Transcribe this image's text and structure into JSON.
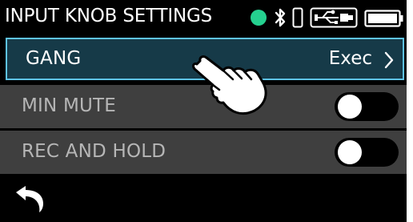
{
  "header": {
    "title": "INPUT KNOB SETTINGS",
    "status_dot_color": "#25d08f",
    "icons": [
      "bluetooth-icon",
      "phone-icon",
      "usb-icon",
      "battery-icon"
    ]
  },
  "rows": {
    "gang": {
      "label": "GANG",
      "value": "Exec"
    },
    "min_mute": {
      "label": "MIN MUTE",
      "toggle": "off"
    },
    "rec_and_hold": {
      "label": "REC AND HOLD",
      "toggle": "off"
    }
  },
  "colors": {
    "selected_row_bg": "#163a48",
    "selected_row_border": "#5ec3e6",
    "row_bg": "#3f3f3f",
    "disabled_text": "#b6b6b6"
  },
  "footer": {
    "back_icon": "back-arrow-icon"
  },
  "pointer": {
    "icon": "hand-pointer-icon"
  }
}
